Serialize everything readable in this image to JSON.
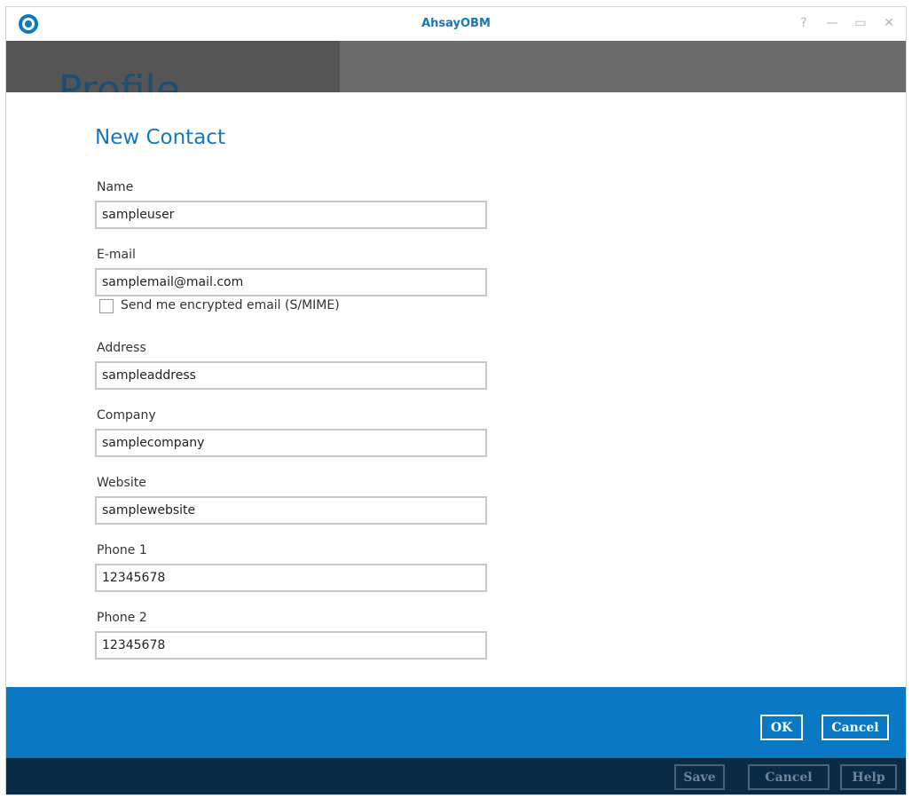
{
  "window": {
    "title": "AhsayOBM",
    "controls": {
      "help": "?",
      "minimize": "—",
      "maximize": "▭",
      "close": "✕"
    }
  },
  "header": {
    "title": "Profile"
  },
  "form": {
    "title": "New Contact",
    "fields": {
      "name": {
        "label": "Name",
        "value": "sampleuser"
      },
      "email": {
        "label": "E-mail",
        "value": "samplemail@mail.com"
      },
      "smime": {
        "label": "Send me encrypted email (S/MIME)",
        "checked": false
      },
      "address": {
        "label": "Address",
        "value": "sampleaddress"
      },
      "company": {
        "label": "Company",
        "value": "samplecompany"
      },
      "website": {
        "label": "Website",
        "value": "samplewebsite"
      },
      "phone1": {
        "label": "Phone 1",
        "value": "12345678"
      },
      "phone2": {
        "label": "Phone 2",
        "value": "12345678"
      }
    }
  },
  "dialog_buttons": {
    "ok": "OK",
    "cancel": "Cancel"
  },
  "footer_buttons": {
    "save": "Save",
    "cancel": "Cancel",
    "help": "Help"
  },
  "colors": {
    "accent": "#0a78c2",
    "footer": "#0a2b45",
    "header_band": "#6b6b6b",
    "title_text": "#1677c0"
  }
}
